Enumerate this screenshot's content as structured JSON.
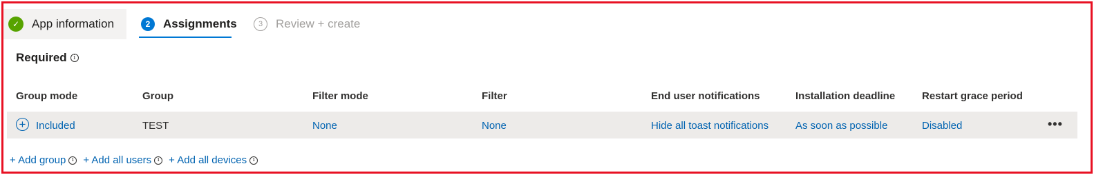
{
  "steps": [
    {
      "number": "",
      "label": "App information",
      "state": "completed"
    },
    {
      "number": "2",
      "label": "Assignments",
      "state": "active"
    },
    {
      "number": "3",
      "label": "Review + create",
      "state": "pending"
    }
  ],
  "section": {
    "title": "Required",
    "info_icon": "info-icon"
  },
  "table": {
    "headers": [
      "Group mode",
      "Group",
      "Filter mode",
      "Filter",
      "End user notifications",
      "Installation deadline",
      "Restart grace period"
    ],
    "rows": [
      {
        "group_mode": "Included",
        "group": "TEST",
        "filter_mode": "None",
        "filter": "None",
        "end_user_notifications": "Hide all toast notifications",
        "installation_deadline": "As soon as possible",
        "restart_grace_period": "Disabled",
        "more_label": "•••"
      }
    ]
  },
  "actions": {
    "add_group": "+ Add group",
    "add_all_users": "+ Add all users",
    "add_all_devices": "+ Add all devices"
  },
  "colors": {
    "accent": "#0078d4",
    "link": "#0063b1",
    "success": "#57a300",
    "highlight_border": "#e81123",
    "row_bg": "#edebe9"
  }
}
